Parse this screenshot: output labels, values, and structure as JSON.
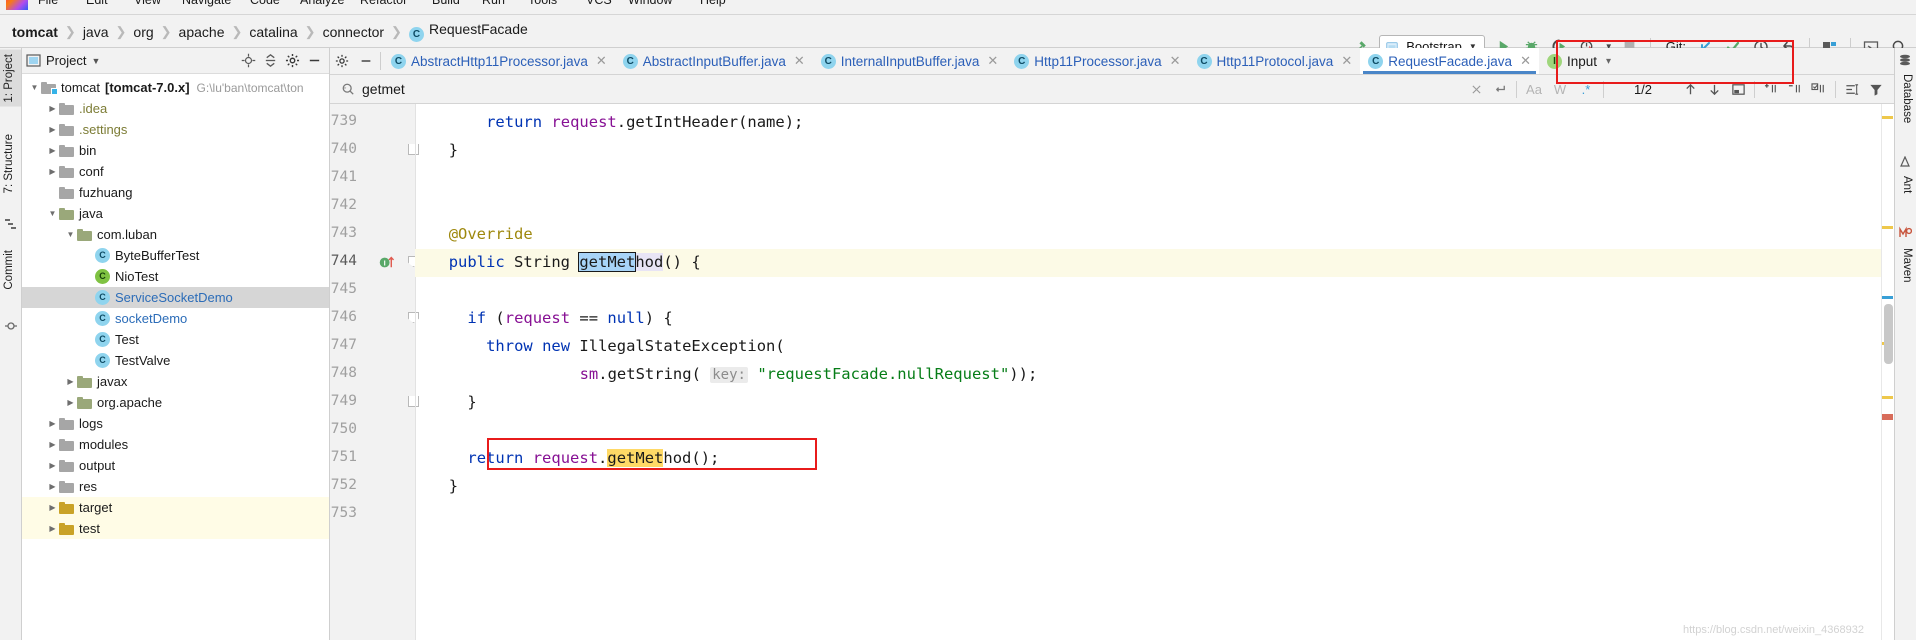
{
  "menu": {
    "items": [
      "File",
      "Edit",
      "View",
      "Navigate",
      "Code",
      "Analyze",
      "Refactor",
      "Build",
      "Run",
      "Tools",
      "VCS",
      "Window",
      "Help"
    ]
  },
  "breadcrumb": {
    "items": [
      "tomcat",
      "java",
      "org",
      "apache",
      "catalina",
      "connector"
    ],
    "current_file": "RequestFacade",
    "current_icon": "C"
  },
  "toolbar": {
    "build_label": "build-hammer-icon",
    "run_config": "Bootstrap",
    "run_label": "run-icon",
    "debug_label": "debug-icon",
    "coverage_label": "run-with-coverage-icon",
    "profile_label": "profiler-icon",
    "stop_label": "stop-icon",
    "git_label": "Git:",
    "git_update": "update-project-icon",
    "git_commit": "commit-icon",
    "git_history": "history-icon",
    "git_rollback": "rollback-icon",
    "layout_label": "layout-icon",
    "terminal_label": "terminal-icon",
    "search_label": "search-everywhere-icon"
  },
  "left_strip": {
    "tabs": [
      "1: Project",
      "7: Structure",
      "Commit"
    ]
  },
  "right_strip": {
    "tabs": [
      "Database",
      "Ant",
      "Maven"
    ]
  },
  "project_panel": {
    "title": "Project",
    "icons": [
      "locate-icon",
      "collapse-all-icon",
      "settings-icon",
      "hide-icon"
    ],
    "tree": [
      {
        "depth": 0,
        "arrow": "open",
        "icon": "module",
        "label": "tomcat",
        "bold_suffix": "[tomcat-7.0.x]",
        "path": "G:\\lu'ban\\tomcat\\ton",
        "style": "plain"
      },
      {
        "depth": 1,
        "arrow": "closed",
        "icon": "folder",
        "label": ".idea",
        "style": "olive"
      },
      {
        "depth": 1,
        "arrow": "closed",
        "icon": "folder",
        "label": ".settings",
        "style": "olive"
      },
      {
        "depth": 1,
        "arrow": "closed",
        "icon": "folder",
        "label": "bin",
        "style": "plain"
      },
      {
        "depth": 1,
        "arrow": "closed",
        "icon": "folder",
        "label": "conf",
        "style": "plain"
      },
      {
        "depth": 1,
        "arrow": "none",
        "icon": "folder",
        "label": "fuzhuang",
        "style": "plain"
      },
      {
        "depth": 1,
        "arrow": "open",
        "icon": "folder-src",
        "label": "java",
        "style": "plain"
      },
      {
        "depth": 2,
        "arrow": "open",
        "icon": "folder-pkg",
        "label": "com.luban",
        "style": "plain"
      },
      {
        "depth": 3,
        "arrow": "none",
        "icon": "class",
        "label": "ByteBufferTest",
        "style": "plain"
      },
      {
        "depth": 3,
        "arrow": "none",
        "icon": "class-run",
        "label": "NioTest",
        "style": "plain"
      },
      {
        "depth": 3,
        "arrow": "none",
        "icon": "class",
        "label": "ServiceSocketDemo",
        "style": "blue",
        "selected": true
      },
      {
        "depth": 3,
        "arrow": "none",
        "icon": "class",
        "label": "socketDemo",
        "style": "blue"
      },
      {
        "depth": 3,
        "arrow": "none",
        "icon": "class",
        "label": "Test",
        "style": "plain"
      },
      {
        "depth": 3,
        "arrow": "none",
        "icon": "class",
        "label": "TestValve",
        "style": "plain"
      },
      {
        "depth": 2,
        "arrow": "closed",
        "icon": "folder-pkg",
        "label": "javax",
        "style": "plain"
      },
      {
        "depth": 2,
        "arrow": "closed",
        "icon": "folder-pkg",
        "label": "org.apache",
        "style": "plain"
      },
      {
        "depth": 1,
        "arrow": "closed",
        "icon": "folder",
        "label": "logs",
        "style": "plain"
      },
      {
        "depth": 1,
        "arrow": "closed",
        "icon": "folder",
        "label": "modules",
        "style": "plain"
      },
      {
        "depth": 1,
        "arrow": "closed",
        "icon": "folder",
        "label": "output",
        "style": "plain"
      },
      {
        "depth": 1,
        "arrow": "closed",
        "icon": "folder",
        "label": "res",
        "style": "plain"
      },
      {
        "depth": 1,
        "arrow": "closed",
        "icon": "folder-target",
        "label": "target",
        "style": "plain",
        "highlight": true
      },
      {
        "depth": 1,
        "arrow": "closed",
        "icon": "folder-test",
        "label": "test",
        "style": "plain",
        "highlight": true
      }
    ]
  },
  "editor": {
    "tabs": [
      {
        "label": "AbstractHttp11Processor.java",
        "icon": "C",
        "active": false
      },
      {
        "label": "AbstractInputBuffer.java",
        "icon": "C",
        "active": false
      },
      {
        "label": "InternalInputBuffer.java",
        "icon": "C",
        "active": false
      },
      {
        "label": "Http11Processor.java",
        "icon": "C",
        "active": false
      },
      {
        "label": "Http11Protocol.java",
        "icon": "C",
        "active": false
      },
      {
        "label": "RequestFacade.java",
        "icon": "C",
        "active": true
      }
    ],
    "input_tab": {
      "label": "Input",
      "icon": "I"
    },
    "gear_icon": "settings-icon",
    "minimize_icon": "hide-icon"
  },
  "search": {
    "value": "getmet",
    "count": "1/2",
    "match_case": "Aa",
    "words": "W",
    "regex": ".*",
    "regex_active": true,
    "prev_icon": "arrow-up-icon",
    "next_icon": "arrow-down-icon",
    "select_all_icon": "select-all-occurrences-icon",
    "add_line_icon": "add-line-icon",
    "remove_line_icon": "remove-line-icon",
    "check_line_icon": "check-line-icon",
    "in_selection_icon": "in-selection-icon",
    "filter_icon": "filter-icon",
    "close_icon": "close-icon",
    "history_icon": "history-icon"
  },
  "code": {
    "lines": [
      {
        "num": "739",
        "indent": 3,
        "tokens": [
          {
            "t": "return ",
            "c": "kw"
          },
          {
            "t": "request",
            "c": "fld"
          },
          {
            "t": ".getIntHeader(name);",
            "c": ""
          }
        ]
      },
      {
        "num": "740",
        "indent": 1,
        "fold": "end",
        "tokens": [
          {
            "t": "}",
            "c": ""
          }
        ]
      },
      {
        "num": "741",
        "indent": 0,
        "tokens": []
      },
      {
        "num": "742",
        "indent": 0,
        "tokens": []
      },
      {
        "num": "743",
        "indent": 1,
        "tokens": [
          {
            "t": "@Override",
            "c": "ann"
          }
        ]
      },
      {
        "num": "744",
        "indent": 1,
        "highlight": true,
        "gutter": "inherit-impl",
        "fold": "start",
        "tokens": [
          {
            "t": "public ",
            "c": "kw"
          },
          {
            "t": "String ",
            "c": ""
          },
          {
            "t": "getMet",
            "c": "match-cur"
          },
          {
            "t": "hod",
            "c": "match-tail"
          },
          {
            "t": "() {",
            "c": ""
          }
        ]
      },
      {
        "num": "745",
        "indent": 0,
        "tokens": []
      },
      {
        "num": "746",
        "indent": 2,
        "fold": "start",
        "tokens": [
          {
            "t": "if ",
            "c": "kw"
          },
          {
            "t": "(",
            "c": ""
          },
          {
            "t": "request",
            "c": "fld"
          },
          {
            "t": " == ",
            "c": ""
          },
          {
            "t": "null",
            "c": "kw"
          },
          {
            "t": ") {",
            "c": ""
          }
        ]
      },
      {
        "num": "747",
        "indent": 3,
        "tokens": [
          {
            "t": "throw new ",
            "c": "kw"
          },
          {
            "t": "IllegalStateException(",
            "c": ""
          }
        ]
      },
      {
        "num": "748",
        "indent": 8,
        "tokens": [
          {
            "t": "sm",
            "c": "fld"
          },
          {
            "t": ".getString( ",
            "c": ""
          },
          {
            "t": "key:",
            "c": "hintk"
          },
          {
            "t": " ",
            "c": ""
          },
          {
            "t": "\"requestFacade.nullRequest\"",
            "c": "str"
          },
          {
            "t": "));",
            "c": ""
          }
        ]
      },
      {
        "num": "749",
        "indent": 2,
        "fold": "end",
        "tokens": [
          {
            "t": "}",
            "c": ""
          }
        ]
      },
      {
        "num": "750",
        "indent": 0,
        "tokens": []
      },
      {
        "num": "751",
        "indent": 2,
        "boxed": true,
        "tokens": [
          {
            "t": "return ",
            "c": "kw"
          },
          {
            "t": "request",
            "c": "fld"
          },
          {
            "t": ".",
            "c": ""
          },
          {
            "t": "getMet",
            "c": "match-y"
          },
          {
            "t": "hod();",
            "c": ""
          }
        ]
      },
      {
        "num": "752",
        "indent": 1,
        "tokens": [
          {
            "t": "}",
            "c": ""
          }
        ]
      },
      {
        "num": "753",
        "indent": 0,
        "tokens": []
      }
    ]
  },
  "watermark": "https://blog.csdn.net/weixin_4368932",
  "colors": {
    "accent_blue": "#2b5fb8",
    "annotation_red": "#e81b1b",
    "keyword": "#0033b3",
    "field": "#871094",
    "string": "#067d17",
    "annotation_gold": "#9e880d",
    "match_current": "#a8d4f7",
    "match_yellow": "#ffd966",
    "line_highlight": "#fcfae6"
  }
}
